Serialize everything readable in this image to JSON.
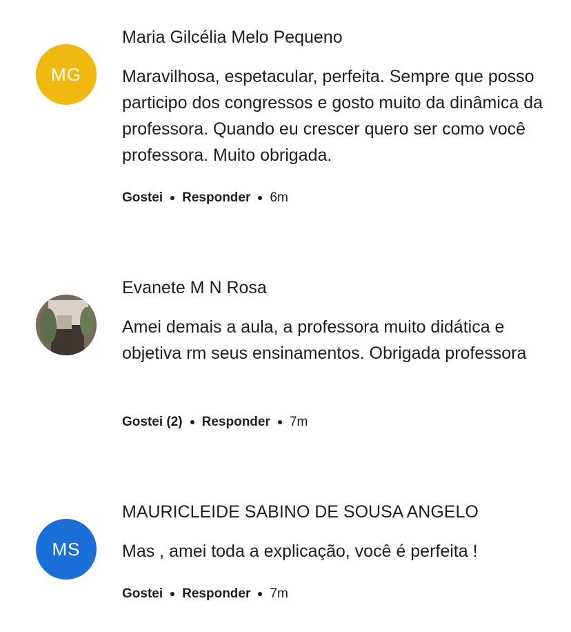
{
  "comments": [
    {
      "initials": "MG",
      "avatar_color": "#f0b90f",
      "author": "Maria Gilcélia Melo Pequeno",
      "text": "Maravilhosa, espetacular, perfeita. Sempre que posso participo dos congressos e gosto muito da dinâmica da professora. Quando eu crescer quero ser como você professora. Muito obrigada.",
      "like_label": "Gostei",
      "reply_label": "Responder",
      "time": "6m"
    },
    {
      "initials": "",
      "avatar_color": "#6b5e52",
      "author": "Evanete M N Rosa",
      "text": "Amei demais a aula, a professora muito didática e objetiva rm seus ensinamentos. Obrigada professora",
      "like_label": "Gostei (2)",
      "reply_label": "Responder",
      "time": "7m"
    },
    {
      "initials": "MS",
      "avatar_color": "#1b6fd8",
      "author": "MAURICLEIDE SABINO DE SOUSA ANGELO",
      "text": "Mas , amei toda a explicação, você é perfeita !",
      "like_label": "Gostei",
      "reply_label": "Responder",
      "time": "7m"
    }
  ]
}
